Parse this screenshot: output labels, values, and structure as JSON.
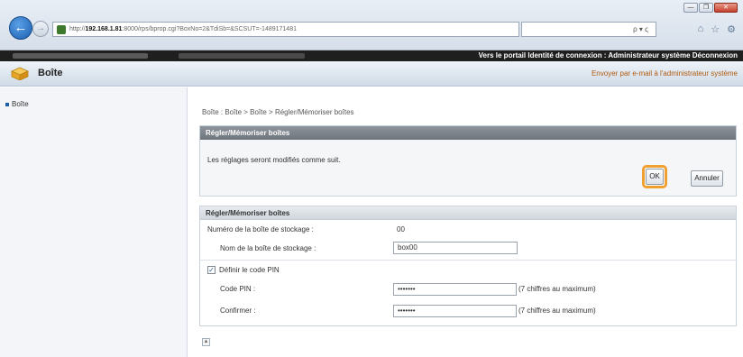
{
  "browser": {
    "url_prefix": "http://",
    "url_host": "192.168.1.81",
    "url_rest": ":8000/rps/bprop.cgi?BoxNo=2&TdiSb=&SCSUT=-1489171481",
    "search_hint": "ρ ▾ ς",
    "window_buttons": [
      "—",
      "❐",
      "✕"
    ]
  },
  "topbar": {
    "links": "Vers le portail   Identité de connexion : Administrateur système   Déconnexion"
  },
  "header": {
    "title": "Boîte",
    "email_link": "Envoyer par e-mail à l'administrateur système"
  },
  "sidebar": {
    "items": [
      {
        "label": "Boîte"
      }
    ]
  },
  "breadcrumb": "Boîte : Boîte > Boîte > Régler/Mémoriser boîtes",
  "confirm_panel": {
    "title": "Régler/Mémoriser boîtes",
    "message": "Les réglages seront modifiés comme suit.",
    "ok_label": "OK",
    "cancel_label": "Annuler"
  },
  "settings_panel": {
    "title": "Régler/Mémoriser boîtes",
    "box_number_label": "Numéro de la boîte de stockage :",
    "box_number_value": "00",
    "box_name_label": "Nom de la boîte de stockage :",
    "box_name_value": "box00",
    "pin_checkbox_label": "Définir le code PIN",
    "pin_checked": true,
    "pin_label": "Code PIN :",
    "pin_value": "•••••••",
    "pin_hint": "(7 chiffres au maximum)",
    "confirm_label": "Confirmer :",
    "confirm_value": "•••••••",
    "confirm_hint": "(7 chiffres au maximum)"
  }
}
